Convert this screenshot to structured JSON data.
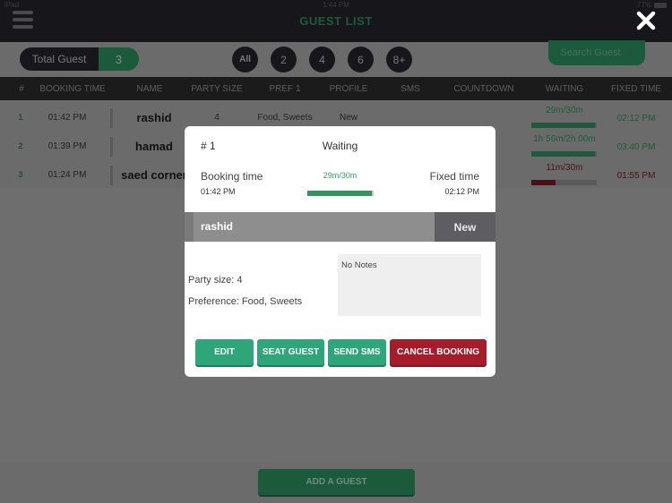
{
  "status_bar": {
    "device": "iPad",
    "time": "1:44 PM",
    "battery": "77%"
  },
  "header": {
    "title": "GUEST LIST",
    "menu_icon": "hamburger-menu-icon",
    "close_icon": "close-icon"
  },
  "filter_bar": {
    "total_label": "Total Guest",
    "total_count": "3",
    "filters": [
      "All",
      "2",
      "4",
      "6",
      "8+"
    ],
    "search_label": "Search Guest",
    "search_icon": "search-icon"
  },
  "table": {
    "columns": [
      "#",
      "BOOKING TIME",
      "NAME",
      "PARTY SIZE",
      "PREF 1",
      "PROFILE",
      "SMS",
      "COUNTDOWN",
      "WAITING",
      "FIXED TIME"
    ],
    "rows": [
      {
        "num": "1",
        "booking_time": "01:42 PM",
        "name": "rashid",
        "party_size": "4",
        "pref": "Food, Sweets",
        "profile": "New",
        "waiting_text": "29m/30m",
        "waiting_progress": 0.97,
        "waiting_color": "#1f5a3c",
        "fixed_time": "02:12 PM",
        "fixed_color": "#1f5a3c"
      },
      {
        "num": "2",
        "booking_time": "01:39 PM",
        "name": "hamad",
        "party_size": "",
        "pref": "",
        "profile": "",
        "waiting_text": "1h 56m/2h 00m",
        "waiting_progress": 0.97,
        "waiting_color": "#1f5a3c",
        "fixed_time": "03:40 PM",
        "fixed_color": "#1f5a3c"
      },
      {
        "num": "3",
        "booking_time": "01:24 PM",
        "name": "saed corner",
        "party_size": "",
        "pref": "",
        "profile": "",
        "waiting_text": "11m/30m",
        "waiting_progress": 0.37,
        "waiting_color": "#4a1018",
        "fixed_time": "01:55 PM",
        "fixed_color": "#4a1018"
      }
    ]
  },
  "bottom": {
    "add_label": "ADD A GUEST"
  },
  "modal": {
    "id": "# 1",
    "status": "Waiting",
    "booking_label": "Booking time",
    "booking_value": "01:42 PM",
    "waiting_text": "29m/30m",
    "waiting_progress": 0.97,
    "fixed_label": "Fixed time",
    "fixed_value": "02:12 PM",
    "guest_name": "rashid",
    "profile": "New",
    "party_size_text": "Party size:   4",
    "preference_text": "Preference: Food, Sweets",
    "notes": "No Notes",
    "actions": [
      {
        "label": "EDIT",
        "variant": "green"
      },
      {
        "label": "SEAT GUEST",
        "variant": "green"
      },
      {
        "label": "SEND SMS",
        "variant": "green"
      },
      {
        "label": "CANCEL BOOKING",
        "variant": "red"
      }
    ]
  },
  "colors": {
    "accent_green": "#2fa57a",
    "danger_red": "#a51d2a",
    "dark_bg": "#17161b"
  }
}
